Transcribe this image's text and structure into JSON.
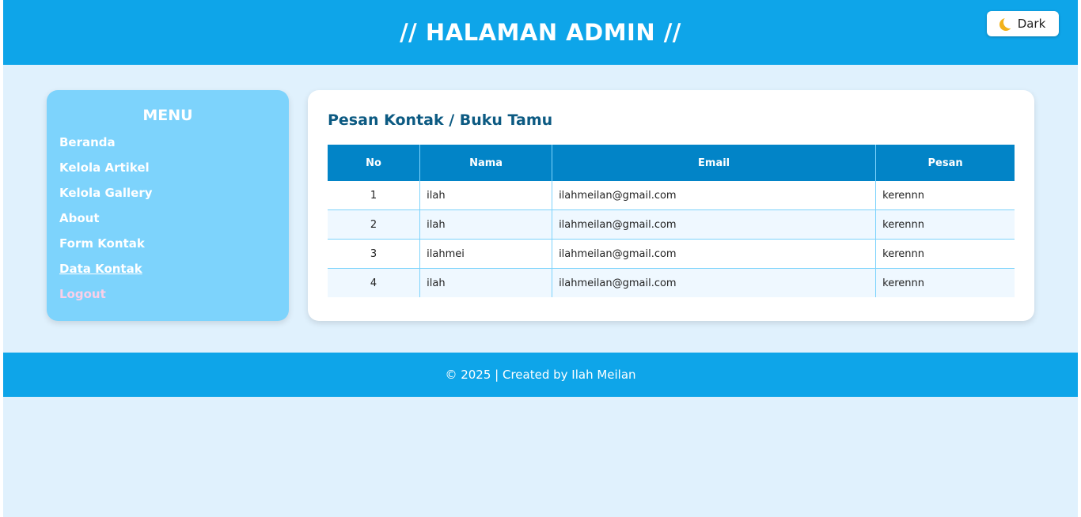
{
  "header": {
    "title": "// HALAMAN ADMIN //",
    "theme_toggle": {
      "icon": "moon-icon",
      "label": "Dark"
    }
  },
  "sidebar": {
    "title": "MENU",
    "items": [
      {
        "label": "Beranda"
      },
      {
        "label": "Kelola Artikel"
      },
      {
        "label": "Kelola Gallery"
      },
      {
        "label": "About"
      },
      {
        "label": "Form Kontak"
      },
      {
        "label": "Data Kontak",
        "active": true
      },
      {
        "label": "Logout"
      }
    ]
  },
  "main": {
    "title": "Pesan Kontak / Buku Tamu",
    "table": {
      "columns": [
        "No",
        "Nama",
        "Email",
        "Pesan"
      ],
      "rows": [
        [
          "1",
          "ilah",
          "ilahmeilan@gmail.com",
          "kerennn"
        ],
        [
          "2",
          "ilah",
          "ilahmeilan@gmail.com",
          "kerennn"
        ],
        [
          "3",
          "ilahmei",
          "ilahmeilan@gmail.com",
          "kerennn"
        ],
        [
          "4",
          "ilah",
          "ilahmeilan@gmail.com",
          "kerennn"
        ]
      ]
    }
  },
  "footer": {
    "text": "© 2025 | Created by Ilah Meilan"
  },
  "colors": {
    "header_bg": "#0ea5e9",
    "page_bg": "#e0f1fd",
    "sidebar_bg": "#7dd3fc",
    "table_header_bg": "#0284c7",
    "title_color": "#0c5a82",
    "logout_color": "#fbcfe8"
  }
}
